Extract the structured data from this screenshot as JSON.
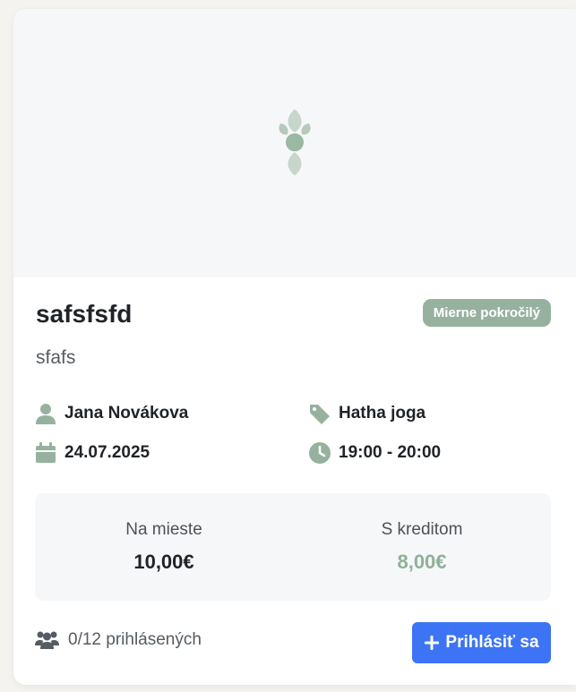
{
  "card": {
    "title": "safsfsfd",
    "level_badge": "Mierne pokročilý",
    "description": "sfafs",
    "instructor": {
      "icon": "user-icon",
      "name": "Jana Novákova"
    },
    "category": {
      "icon": "tag-icon",
      "name": "Hatha joga"
    },
    "date": {
      "icon": "calendar-icon",
      "value": "24.07.2025"
    },
    "time": {
      "icon": "clock-icon",
      "value": "19:00 - 20:00"
    },
    "prices": {
      "onsite_label": "Na mieste",
      "onsite_value": "10,00€",
      "credit_label": "S kreditom",
      "credit_value": "8,00€"
    },
    "enrolled": {
      "icon": "users-icon",
      "text": "0/12 prihlásených"
    },
    "signup_button": {
      "icon": "plus-icon",
      "label": "Prihlásiť sa"
    }
  },
  "colors": {
    "accent_green": "#96b29f",
    "button_blue": "#3d74f5",
    "price_credit": "#8fb09a"
  }
}
